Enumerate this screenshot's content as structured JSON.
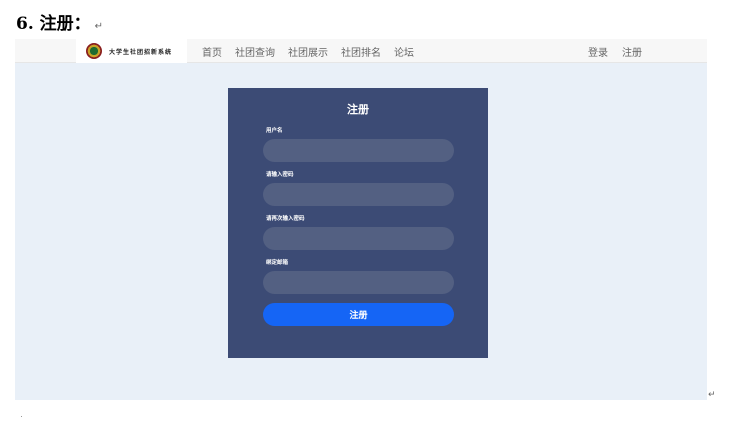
{
  "doc": {
    "heading": "6. 注册：",
    "paragraph_mark": "↵"
  },
  "navbar": {
    "brand_name": "大学生社团招新系统",
    "links": [
      "首页",
      "社团查询",
      "社团展示",
      "社团排名",
      "论坛"
    ],
    "right_links": [
      "登录",
      "注册"
    ]
  },
  "form": {
    "title": "注册",
    "fields": [
      {
        "label": "用户名",
        "value": ""
      },
      {
        "label": "请输入密码",
        "value": ""
      },
      {
        "label": "请再次输入密码",
        "value": ""
      },
      {
        "label": "绑定邮箱",
        "value": ""
      }
    ],
    "submit_label": "注册"
  },
  "colors": {
    "page_bg": "#e9f0f8",
    "card_bg": "#3c4b75",
    "input_bg": "#536082",
    "button_bg": "#1565f5"
  },
  "icons": {
    "logo": "university-emblem-icon"
  }
}
